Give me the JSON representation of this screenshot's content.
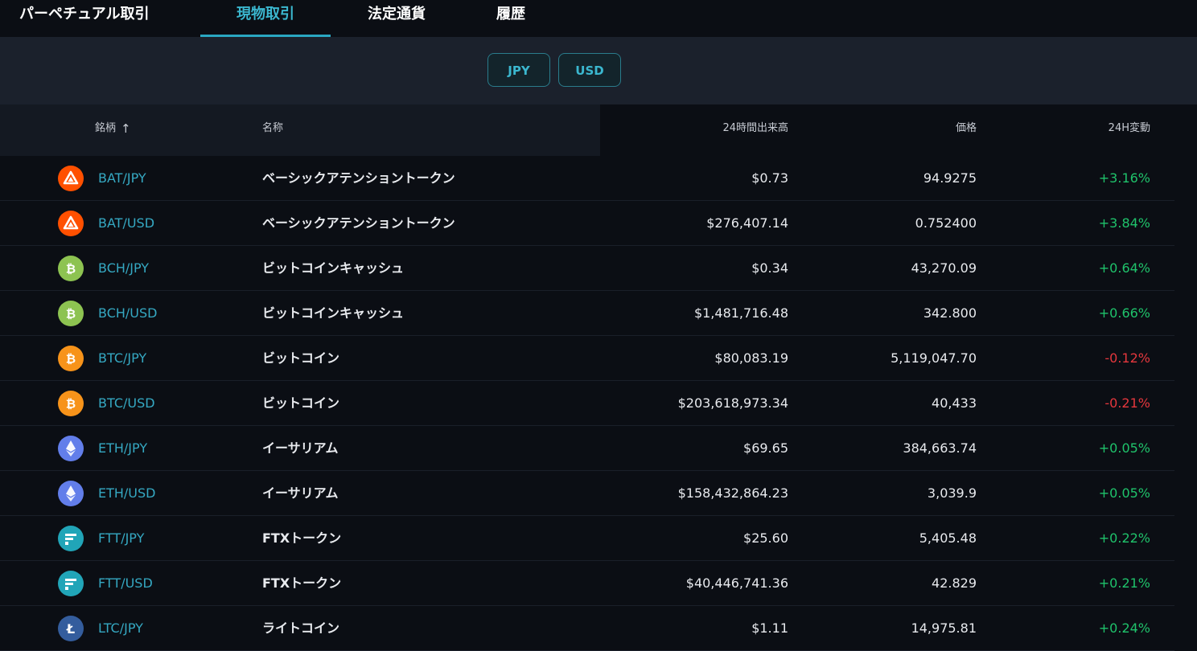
{
  "nav": {
    "tabs": [
      {
        "label": "パーペチュアル取引",
        "active": false
      },
      {
        "label": "現物取引",
        "active": true
      },
      {
        "label": "法定通貨",
        "active": false
      },
      {
        "label": "履歴",
        "active": false
      }
    ]
  },
  "filters": {
    "currencies": [
      "JPY",
      "USD"
    ]
  },
  "table": {
    "headers": {
      "symbol": "銘柄",
      "sort_icon": "arrow-up-icon",
      "name": "名称",
      "volume": "24時間出来高",
      "price": "価格",
      "change": "24H変動"
    },
    "rows": [
      {
        "icon": "bat-icon",
        "pair": "BAT/JPY",
        "name": "ベーシックアテンショントークン",
        "volume": "$0.73",
        "price": "94.9275",
        "change": "+3.16%",
        "direction": "up"
      },
      {
        "icon": "bat-icon",
        "pair": "BAT/USD",
        "name": "ベーシックアテンショントークン",
        "volume": "$276,407.14",
        "price": "0.752400",
        "change": "+3.84%",
        "direction": "up"
      },
      {
        "icon": "bch-icon",
        "pair": "BCH/JPY",
        "name": "ビットコインキャッシュ",
        "volume": "$0.34",
        "price": "43,270.09",
        "change": "+0.64%",
        "direction": "up"
      },
      {
        "icon": "bch-icon",
        "pair": "BCH/USD",
        "name": "ビットコインキャッシュ",
        "volume": "$1,481,716.48",
        "price": "342.800",
        "change": "+0.66%",
        "direction": "up"
      },
      {
        "icon": "btc-icon",
        "pair": "BTC/JPY",
        "name": "ビットコイン",
        "volume": "$80,083.19",
        "price": "5,119,047.70",
        "change": "-0.12%",
        "direction": "down"
      },
      {
        "icon": "btc-icon",
        "pair": "BTC/USD",
        "name": "ビットコイン",
        "volume": "$203,618,973.34",
        "price": "40,433",
        "change": "-0.21%",
        "direction": "down"
      },
      {
        "icon": "eth-icon",
        "pair": "ETH/JPY",
        "name": "イーサリアム",
        "volume": "$69.65",
        "price": "384,663.74",
        "change": "+0.05%",
        "direction": "up"
      },
      {
        "icon": "eth-icon",
        "pair": "ETH/USD",
        "name": "イーサリアム",
        "volume": "$158,432,864.23",
        "price": "3,039.9",
        "change": "+0.05%",
        "direction": "up"
      },
      {
        "icon": "ftt-icon",
        "pair": "FTT/JPY",
        "name": "FTXトークン",
        "volume": "$25.60",
        "price": "5,405.48",
        "change": "+0.22%",
        "direction": "up"
      },
      {
        "icon": "ftt-icon",
        "pair": "FTT/USD",
        "name": "FTXトークン",
        "volume": "$40,446,741.36",
        "price": "42.829",
        "change": "+0.21%",
        "direction": "up"
      },
      {
        "icon": "ltc-icon",
        "pair": "LTC/JPY",
        "name": "ライトコイン",
        "volume": "$1.11",
        "price": "14,975.81",
        "change": "+0.24%",
        "direction": "up"
      }
    ]
  },
  "colors": {
    "accent": "#3bb7cf",
    "positive": "#1fc36b",
    "negative": "#e5373d",
    "background": "#0b0e14",
    "bat": "#ff5000",
    "bch": "#8dc351",
    "btc": "#f7931a",
    "eth": "#627eea",
    "ftt": "#21a5b8",
    "ltc": "#345d9d"
  }
}
